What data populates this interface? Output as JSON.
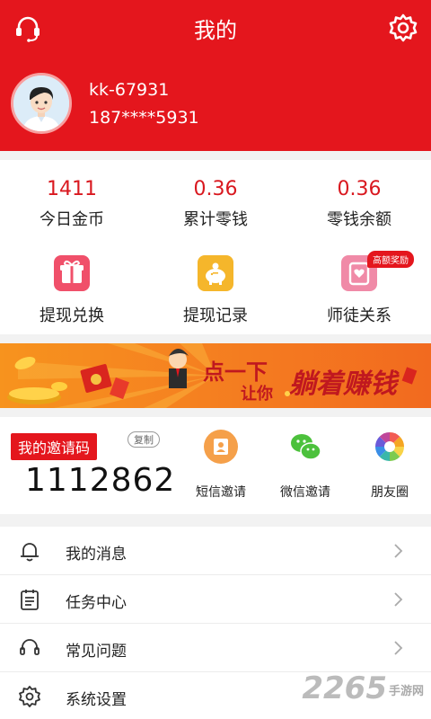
{
  "header": {
    "title": "我的",
    "left_icon": "headset-icon",
    "right_icon": "gear-icon",
    "background": "#e4161d"
  },
  "profile": {
    "username": "kk-67931",
    "phone": "187****5931"
  },
  "stats": [
    {
      "value": "1411",
      "label": "今日金币"
    },
    {
      "value": "0.36",
      "label": "累计零钱"
    },
    {
      "value": "0.36",
      "label": "零钱余额"
    }
  ],
  "functions": [
    {
      "label": "提现兑换",
      "icon": "gift-box-icon",
      "color": "#f0506a"
    },
    {
      "label": "提现记录",
      "icon": "piggy-bank-icon",
      "color": "#f5b62b"
    },
    {
      "label": "师徒关系",
      "icon": "heart-card-icon",
      "color": "#f08aa7",
      "badge": "高额奖励"
    }
  ],
  "banner": {
    "text_1": "点一下",
    "text_2": "让你",
    "text_3": "躺着赚钱"
  },
  "invite": {
    "title": "我的邀请码",
    "copy_label": "复制",
    "code": "1112862",
    "channels": [
      {
        "label": "短信邀请",
        "icon": "sms-icon",
        "color": "#f5a04a"
      },
      {
        "label": "微信邀请",
        "icon": "wechat-icon",
        "color": "#4cc13c"
      },
      {
        "label": "朋友圈",
        "icon": "moments-icon",
        "color": "#f5a623"
      }
    ]
  },
  "menu": [
    {
      "label": "我的消息",
      "icon": "bell-icon"
    },
    {
      "label": "任务中心",
      "icon": "task-list-icon"
    },
    {
      "label": "常见问题",
      "icon": "headset-icon"
    },
    {
      "label": "系统设置",
      "icon": "gear-icon"
    }
  ],
  "watermark": {
    "text": "2265",
    "suffix": "手游网"
  }
}
